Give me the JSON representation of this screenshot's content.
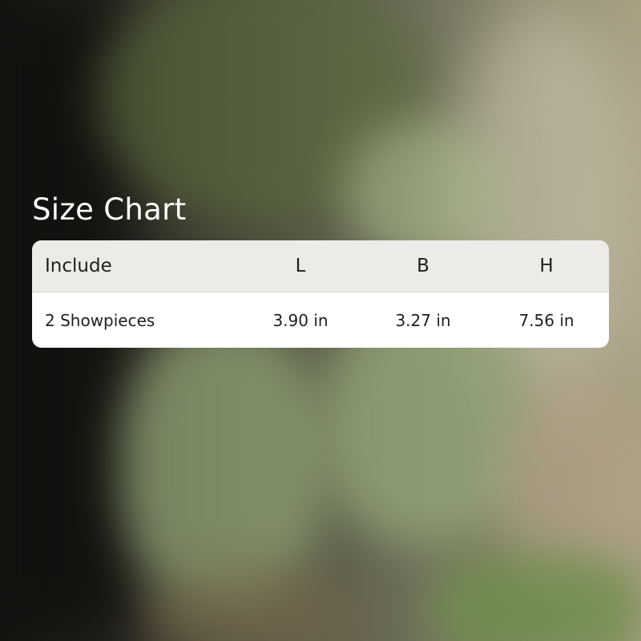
{
  "title": "Size Chart",
  "table": {
    "headers": [
      "Include",
      "L",
      "B",
      "H"
    ],
    "rows": [
      [
        "2 Showpieces",
        "3.90 in",
        "3.27 in",
        "7.56 in"
      ]
    ]
  },
  "colors": {
    "header_background": "#ecebe7",
    "body_background": "#ffffff",
    "title_text": "#ffffff",
    "table_text": "#1f1f1f"
  }
}
